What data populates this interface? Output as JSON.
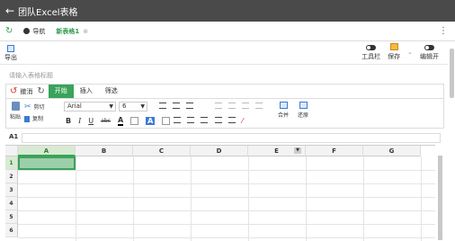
{
  "app": {
    "back_icon": "arrow-left-icon",
    "title": "团队Excel表格"
  },
  "tabbar": {
    "nav_label": "导航",
    "sheet_tab_label": "新表格1",
    "sheet_tab_close": "⊗"
  },
  "toolbar": {
    "export_label": "导出",
    "toolbar_toggle_label": "工具栏",
    "save_label": "保存",
    "edit_label": "编辑开"
  },
  "title_placeholder": "请输入表格标题",
  "ribbon": {
    "undo_label": "撤消",
    "tabs": [
      {
        "label": "开始",
        "active": true
      },
      {
        "label": "插入",
        "active": false
      },
      {
        "label": "筛选",
        "active": false
      }
    ],
    "paste_label": "粘贴",
    "cut_label": "剪切",
    "copy_label": "复制",
    "font_name": "Arial",
    "font_size": "6",
    "bold": "B",
    "italic": "I",
    "underline": "U",
    "strike": "abc",
    "font_color_glyph": "A",
    "fill_color_glyph": "A",
    "merge_label": "合并",
    "restore_label": "还原"
  },
  "formula_bar": {
    "cell_ref": "A1"
  },
  "grid": {
    "columns": [
      "A",
      "B",
      "C",
      "D",
      "E",
      "F",
      "G"
    ],
    "rows": [
      "1",
      "2",
      "3",
      "4",
      "5",
      "6"
    ],
    "selected_cell": "A1"
  },
  "colors": {
    "accent": "#3aa35b",
    "topbar": "#4a4a4a",
    "selected_cell_fill": "#9ccfa9"
  }
}
